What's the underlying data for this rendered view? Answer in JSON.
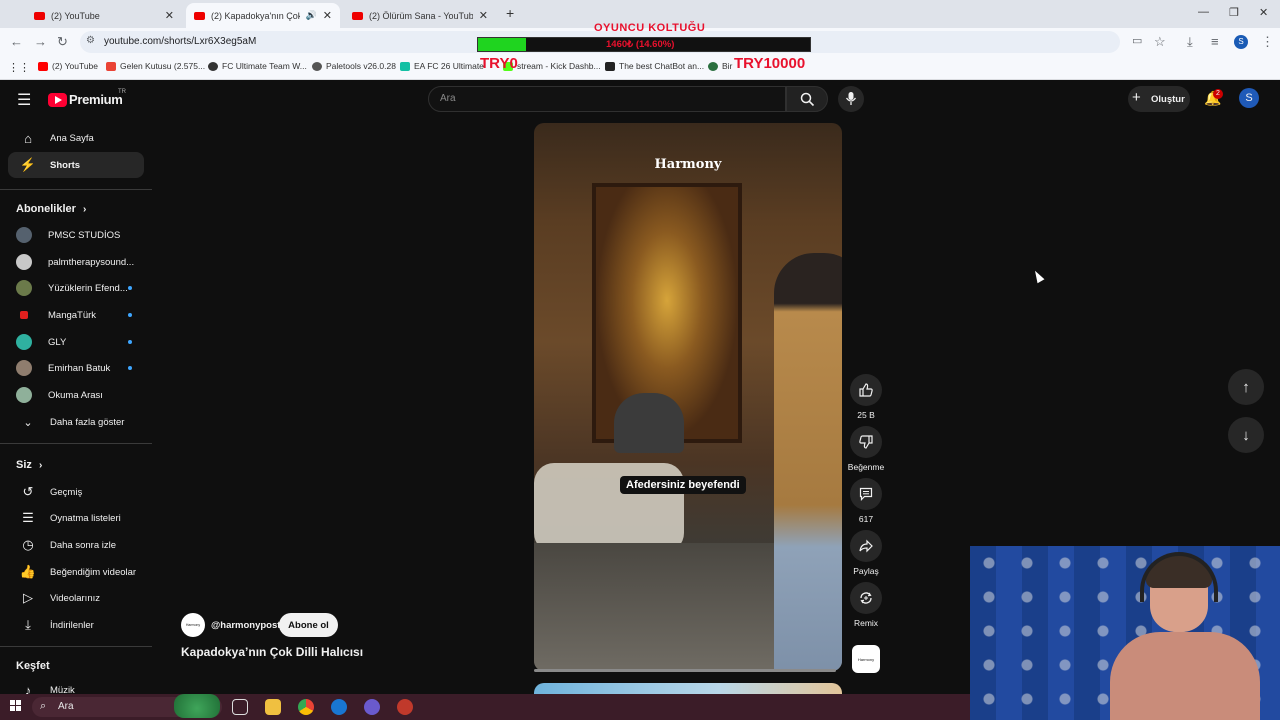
{
  "browser": {
    "tabs": [
      {
        "title": "(2) YouTube"
      },
      {
        "title": "(2) Kapadokya'nın Çok Dilli"
      },
      {
        "title": "(2) Ölürüm Sana - YouTube"
      }
    ],
    "url": "youtube.com/shorts/Lxr6X3eg5aM",
    "bookmarks": [
      {
        "label": "(2) YouTube",
        "color": "#ff0000"
      },
      {
        "label": "Gelen Kutusu (2.575...",
        "color": "#ea4335"
      },
      {
        "label": "FC Ultimate Team W...",
        "color": "#333333"
      },
      {
        "label": "Paletools v26.0.28",
        "color": "#555555"
      },
      {
        "label": "EA FC 26 Ultimate",
        "color": "#13c0a4"
      },
      {
        "label": "stream - Kick Dashb...",
        "color": "#53fc18"
      },
      {
        "label": "The best ChatBot an...",
        "color": "#222222"
      },
      {
        "label": "Bir",
        "color": "#2a6f3f"
      }
    ]
  },
  "overlay": {
    "title": "OYUNCU KOLTUĞU",
    "progress_text": "1460₺ (14.60%)",
    "progress": 0.146,
    "min_label": "TRY0",
    "max_label": "TRY10000"
  },
  "masthead": {
    "logo": "Premium",
    "region": "TR",
    "search_placeholder": "Ara",
    "create_label": "Oluştur",
    "notif_count": "2",
    "account_initial": "S"
  },
  "sidebar": {
    "main": [
      {
        "label": "Ana Sayfa",
        "icon": "home-icon"
      },
      {
        "label": "Shorts",
        "icon": "shorts-icon"
      }
    ],
    "subs_heading": "Abonelikler",
    "subscriptions": [
      {
        "label": "PMSC STUDİOS",
        "color": "#55616e",
        "dot": false
      },
      {
        "label": "palmtherapysound...",
        "color": "#c8c8c8",
        "dot": false
      },
      {
        "label": "Yüzüklerin Efend...",
        "color": "#6b7a4a",
        "dot": true
      },
      {
        "label": "MangaTürk",
        "color": "#e0201e",
        "dot": true
      },
      {
        "label": "GLY",
        "color": "#2fb1a0",
        "dot": true
      },
      {
        "label": "Emirhan Batuk",
        "color": "#8f7d6e",
        "dot": true
      },
      {
        "label": "Okuma Arası",
        "color": "#8fb09a",
        "dot": false
      }
    ],
    "show_more": "Daha fazla göster",
    "you_heading": "Siz",
    "you_items": [
      {
        "label": "Geçmiş"
      },
      {
        "label": "Oynatma listeleri"
      },
      {
        "label": "Daha sonra izle"
      },
      {
        "label": "Beğendiğim videolar"
      },
      {
        "label": "Videolarınız"
      },
      {
        "label": "İndirilenler"
      }
    ],
    "explore_heading": "Keşfet",
    "explore_items": [
      {
        "label": "Müzik"
      }
    ]
  },
  "short": {
    "brand_overlay": "Harmony",
    "caption": "Afedersiniz beyefendi",
    "channel": "@harmonypost",
    "channel_avatar_text": "Harmony",
    "subscribe_label": "Abone ol",
    "title": "Kapadokya’nın Çok Dilli Halıcısı",
    "likes": "25 B",
    "dislike_label": "Beğenme",
    "comments": "617",
    "share_label": "Paylaş",
    "remix_label": "Remix",
    "sound_avatar_text": "Harmony"
  },
  "taskbar": {
    "search_label": "Ara"
  }
}
